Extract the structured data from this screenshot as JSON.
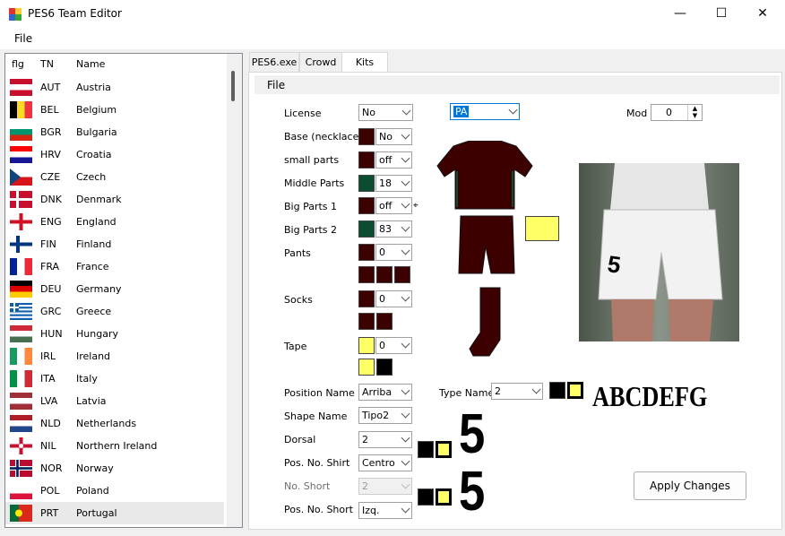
{
  "window": {
    "title": "PES6 Team Editor",
    "minimize": "—",
    "maximize": "☐",
    "close": "✕"
  },
  "menu": {
    "file": "File"
  },
  "list": {
    "headers": {
      "flag": "flg",
      "tn": "TN",
      "name": "Name"
    },
    "rows": [
      {
        "tn": "AUT",
        "name": "Austria"
      },
      {
        "tn": "BEL",
        "name": "Belgium"
      },
      {
        "tn": "BGR",
        "name": "Bulgaria"
      },
      {
        "tn": "HRV",
        "name": "Croatia"
      },
      {
        "tn": "CZE",
        "name": "Czech"
      },
      {
        "tn": "DNK",
        "name": "Denmark"
      },
      {
        "tn": "ENG",
        "name": "England"
      },
      {
        "tn": "FIN",
        "name": "Finland"
      },
      {
        "tn": "FRA",
        "name": "France"
      },
      {
        "tn": "DEU",
        "name": "Germany"
      },
      {
        "tn": "GRC",
        "name": "Greece"
      },
      {
        "tn": "HUN",
        "name": "Hungary"
      },
      {
        "tn": "IRL",
        "name": "Ireland"
      },
      {
        "tn": "ITA",
        "name": "Italy"
      },
      {
        "tn": "LVA",
        "name": "Latvia"
      },
      {
        "tn": "NLD",
        "name": "Netherlands"
      },
      {
        "tn": "NIL",
        "name": "Northern Ireland"
      },
      {
        "tn": "NOR",
        "name": "Norway"
      },
      {
        "tn": "POL",
        "name": "Poland"
      },
      {
        "tn": "PRT",
        "name": "Portugal"
      }
    ],
    "selected_index": 19
  },
  "tabs": [
    "PES6.exe",
    "Crowd",
    "Kits"
  ],
  "kits": {
    "menu_file": "File",
    "license": {
      "label": "License",
      "value": "No"
    },
    "kit_select": "PA",
    "model": {
      "label": "Mod",
      "value": "0"
    },
    "base": {
      "label": "Base (necklace)",
      "value": "No"
    },
    "small_parts": {
      "label": "small parts",
      "value": "off"
    },
    "middle_parts": {
      "label": "Middle Parts",
      "value": "18"
    },
    "big_parts_1": {
      "label": "Big Parts 1",
      "value": "off"
    },
    "big_parts_2": {
      "label": "Big Parts 2",
      "value": "83"
    },
    "pants": {
      "label": "Pants",
      "value": "0"
    },
    "socks": {
      "label": "Socks",
      "value": "0"
    },
    "tape": {
      "label": "Tape",
      "value": "0"
    },
    "position_name": {
      "label": "Position Name",
      "value": "Arriba"
    },
    "type_name": {
      "label": "Type Name",
      "value": "2"
    },
    "shape_name": {
      "label": "Shape Name",
      "value": "Tipo2"
    },
    "dorsal": {
      "label": "Dorsal",
      "value": "2"
    },
    "pos_no_shirt": {
      "label": "Pos. No. Shirt",
      "value": "Centro"
    },
    "no_short": {
      "label": "No. Short",
      "value": "2"
    },
    "pos_no_short": {
      "label": "Pos. No. Short",
      "value": "Izq."
    },
    "font_sample": "ABCDEFG",
    "number_sample": "5",
    "preview_number": "5",
    "apply": "Apply Changes"
  },
  "colors": {
    "maroon": "#3d0000",
    "green": "#0b4d31",
    "yellow": "#ffff66",
    "black": "#000000"
  }
}
